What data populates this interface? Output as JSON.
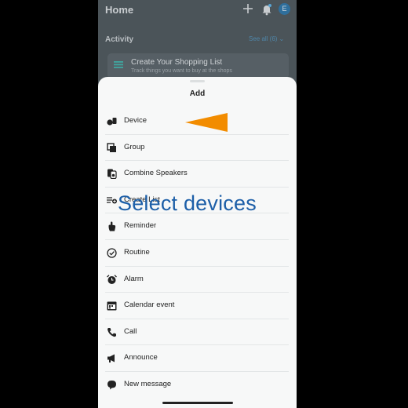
{
  "header": {
    "title": "Home",
    "avatar_initial": "E"
  },
  "activity": {
    "label": "Activity",
    "see_all": "See all (6)",
    "card": {
      "title": "Create Your Shopping List",
      "subtitle": "Track things you want to buy at the shops"
    }
  },
  "sheet": {
    "title": "Add",
    "items": [
      {
        "label": "Device",
        "icon": "device-icon"
      },
      {
        "label": "Group",
        "icon": "group-icon"
      },
      {
        "label": "Combine Speakers",
        "icon": "speakers-icon"
      },
      {
        "label": "Create List",
        "icon": "list-add-icon"
      },
      {
        "label": "Reminder",
        "icon": "reminder-icon"
      },
      {
        "label": "Routine",
        "icon": "routine-icon"
      },
      {
        "label": "Alarm",
        "icon": "alarm-icon"
      },
      {
        "label": "Calendar event",
        "icon": "calendar-icon"
      },
      {
        "label": "Call",
        "icon": "phone-icon"
      },
      {
        "label": "Announce",
        "icon": "megaphone-icon"
      },
      {
        "label": "New message",
        "icon": "message-icon"
      }
    ]
  },
  "overlay": {
    "caption": "Select devices",
    "arrow_color": "#f28c00",
    "caption_color": "#1d5fa8"
  }
}
